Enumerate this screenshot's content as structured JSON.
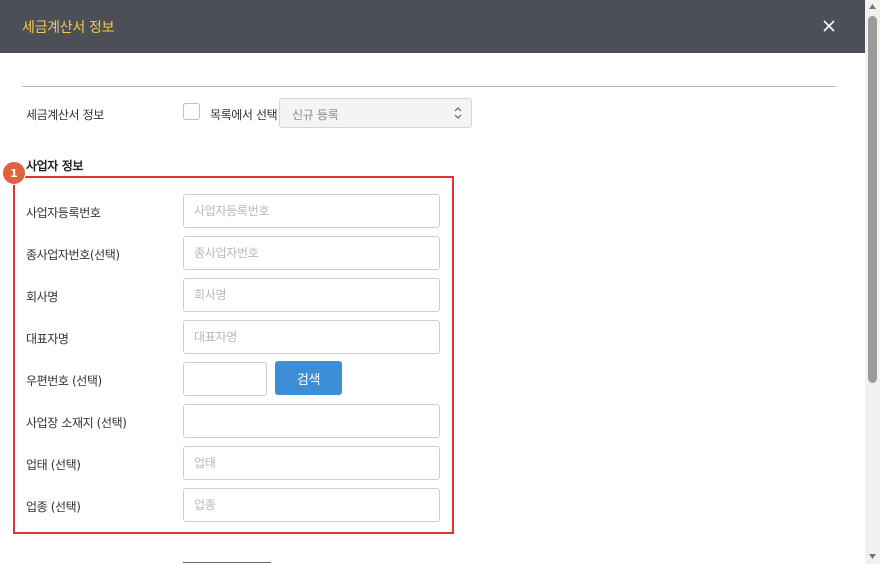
{
  "dialog": {
    "title": "세금계산서 정보"
  },
  "invoice": {
    "label": "세금계산서 정보",
    "checkbox_label": "목록에서 선택",
    "select_value": "신규 등록"
  },
  "section": {
    "title": "사업자 정보",
    "badge": "1"
  },
  "fields": [
    {
      "label": "사업자등록번호",
      "placeholder": "사업자등록번호",
      "value": ""
    },
    {
      "label": "종사업자번호(선택)",
      "placeholder": "종사업자번호",
      "value": ""
    },
    {
      "label": "회사명",
      "placeholder": "회사명",
      "value": ""
    },
    {
      "label": "대표자명",
      "placeholder": "대표자명",
      "value": ""
    },
    {
      "label": "우편번호 (선택)",
      "placeholder": "",
      "value": ""
    },
    {
      "label": "사업장 소재지 (선택)",
      "placeholder": "",
      "value": ""
    },
    {
      "label": "업태 (선택)",
      "placeholder": "업태",
      "value": ""
    },
    {
      "label": "업종 (선택)",
      "placeholder": "업종",
      "value": ""
    }
  ],
  "buttons": {
    "search": "검색"
  },
  "icons": {
    "close": "close-icon",
    "select_arrow": "chevron-updown-icon"
  },
  "colors": {
    "titlebar": "#4c4f57",
    "title": "#f2c94c",
    "accent": "#3c8fd6",
    "highlight": "#d9373a",
    "badge": "#e0623a"
  }
}
